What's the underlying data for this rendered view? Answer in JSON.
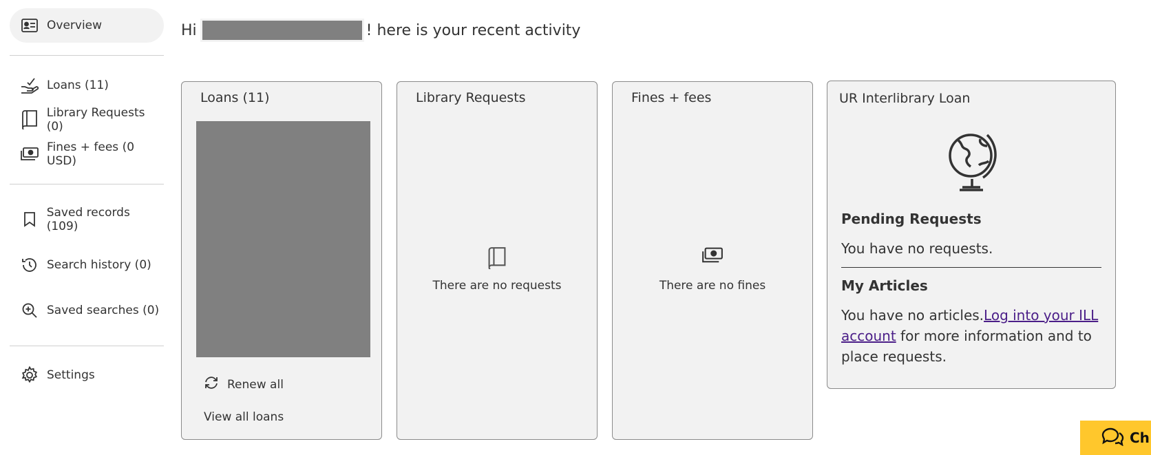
{
  "sidebar": {
    "overview": "Overview",
    "loans": "Loans (11)",
    "requests": "Library Requests (0)",
    "fines": "Fines + fees (0 USD)",
    "saved_records": "Saved records (109)",
    "search_history": "Search history (0)",
    "saved_searches": "Saved searches (0)",
    "settings": "Settings"
  },
  "greeting": {
    "prefix": "Hi",
    "suffix": "! here is your recent activity"
  },
  "loans_card": {
    "title": "Loans (11)",
    "renew_all": "Renew all",
    "view_all": "View all loans"
  },
  "requests_card": {
    "title": "Library Requests",
    "empty": "There are no requests"
  },
  "fines_card": {
    "title": "Fines + fees",
    "empty": "There are no fines"
  },
  "ill_card": {
    "title": "UR Interlibrary Loan",
    "pending_heading": "Pending Requests",
    "pending_text": "You have no requests.",
    "articles_heading": "My Articles",
    "articles_text": "You have no articles.",
    "link_text": "Log into your ILL account",
    "after_link": " for more information and to place requests."
  },
  "chat": {
    "label": "Ch"
  },
  "colors": {
    "card_bg": "#f2f2f2",
    "link": "#4b1e88",
    "chat_bg": "#ffc72c",
    "redaction": "#808080"
  }
}
